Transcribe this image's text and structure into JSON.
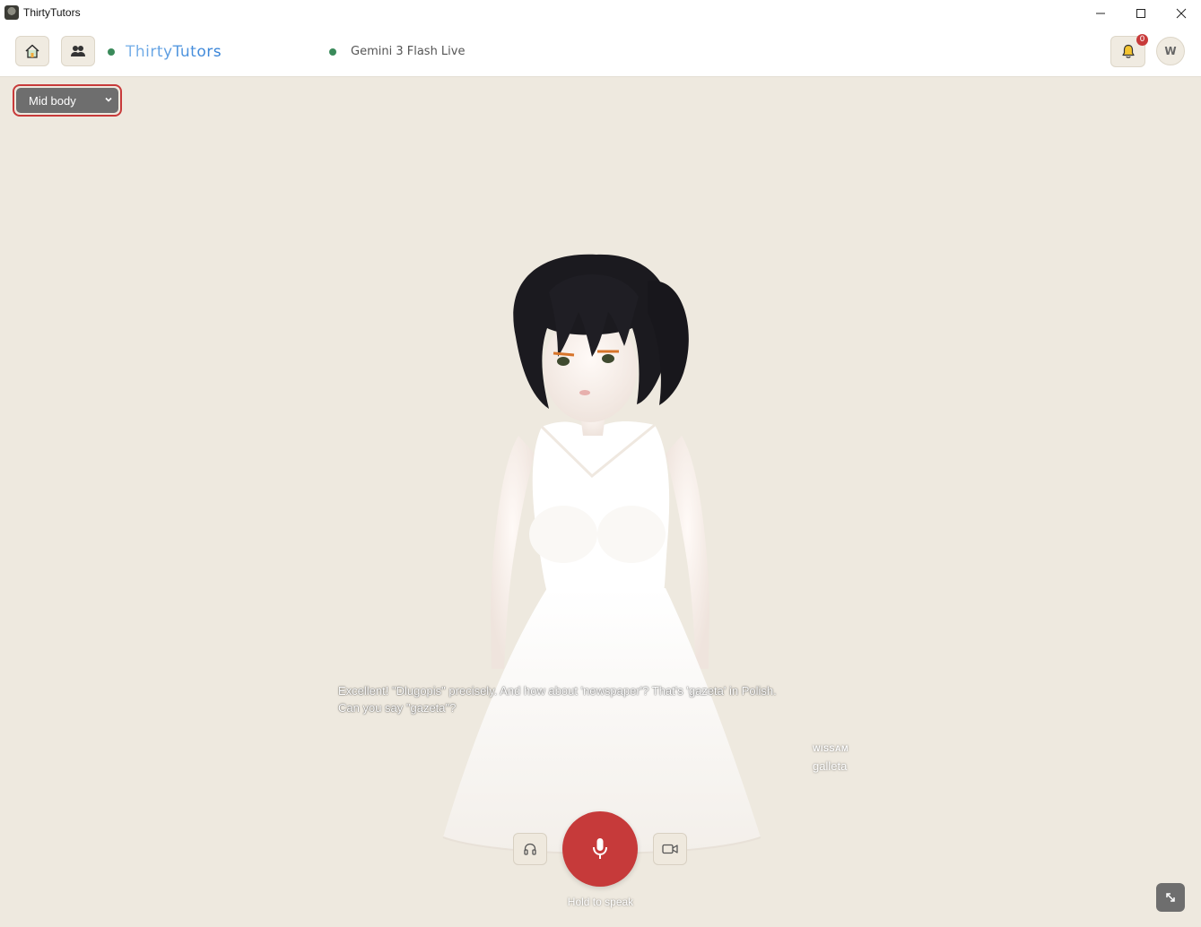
{
  "window": {
    "title": "ThirtyTutors"
  },
  "header": {
    "brand": "ThirtyTutors",
    "model": "Gemini 3 Flash Live",
    "notifications_count": "0",
    "avatar_initial": "W",
    "status_color": "#3a8a5a"
  },
  "view": {
    "selected": "Mid body"
  },
  "conversation": {
    "tutor_line_1": "Excellent! \"Dlugopis\" precisely. And how about 'newspaper'? That's 'gazeta' in Polish.",
    "tutor_line_2": "Can you say \"gazeta\"?",
    "user_name": "WISSAM",
    "user_text": "galleta"
  },
  "controls": {
    "hold_label": "Hold to speak",
    "mic_color": "#c63a3a"
  },
  "icons": {
    "home": "home-icon",
    "people": "people-icon",
    "bell": "bell-icon",
    "headphones": "headphones-icon",
    "microphone": "microphone-icon",
    "video": "video-camera-icon",
    "expand": "expand-icon"
  }
}
